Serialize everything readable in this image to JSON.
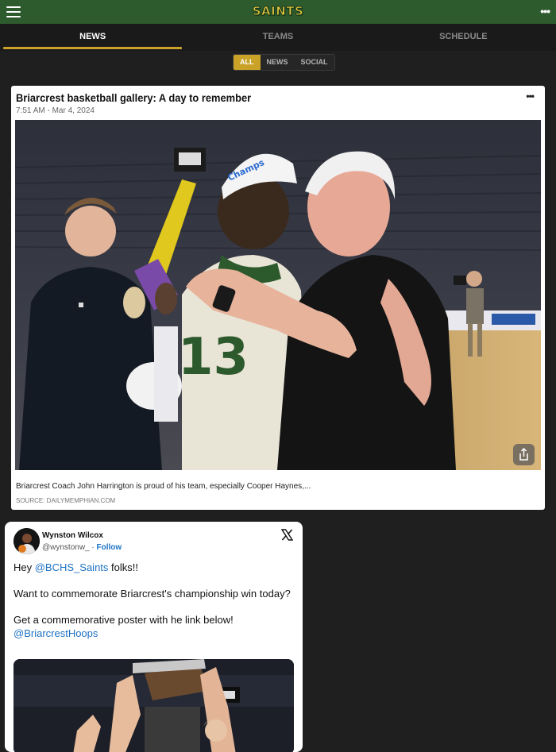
{
  "header": {
    "logo_text": "SAINTS",
    "brand_color": "#2e5b2e",
    "accent_color": "#c9a227"
  },
  "tabs": [
    {
      "label": "NEWS",
      "active": true
    },
    {
      "label": "TEAMS",
      "active": false
    },
    {
      "label": "SCHEDULE",
      "active": false
    }
  ],
  "filters": [
    {
      "label": "ALL",
      "active": true
    },
    {
      "label": "NEWS",
      "active": false
    },
    {
      "label": "SOCIAL",
      "active": false
    }
  ],
  "article": {
    "title": "Briarcrest basketball gallery: A day to remember",
    "timestamp": "7:51 AM - Mar 4, 2024",
    "caption": "Briarcrest Coach John Harrington is proud of his team, especially Cooper Haynes,...",
    "source": "SOURCE: DAILYMEMPHIAN.COM",
    "photo_jersey_number": "13",
    "share_icon": "share-icon",
    "more_icon": "more-horizontal-icon"
  },
  "tweet": {
    "name": "Wynston Wilcox",
    "handle": "@wynstonw_",
    "separator": "·",
    "follow_label": "Follow",
    "text_line1_prefix": "Hey ",
    "text_line1_mention": "@BCHS_Saints",
    "text_line1_suffix": " folks!!",
    "text_para2": "Want to commemorate Briarcrest's championship win today?",
    "text_para3": "Get a commemorative poster with he link below!",
    "text_para3_mention": "@BriarcrestHoops",
    "platform_icon": "x-logo-icon"
  }
}
